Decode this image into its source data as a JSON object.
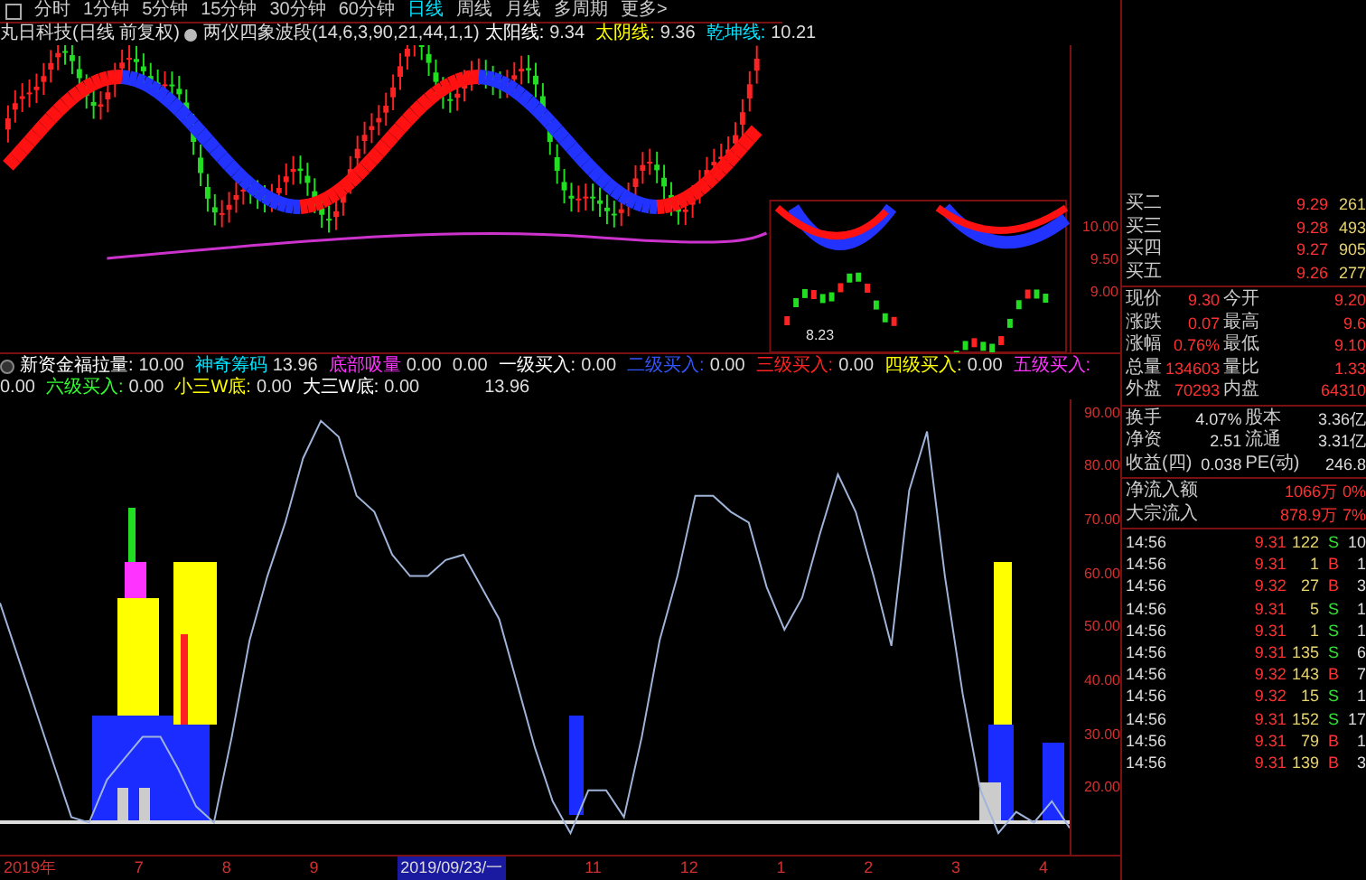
{
  "period_tabs": [
    {
      "label": "分时",
      "selected": false
    },
    {
      "label": "1分钟",
      "selected": false
    },
    {
      "label": "5分钟",
      "selected": false
    },
    {
      "label": "15分钟",
      "selected": false
    },
    {
      "label": "30分钟",
      "selected": false
    },
    {
      "label": "60分钟",
      "selected": false
    },
    {
      "label": "日线",
      "selected": true
    },
    {
      "label": "周线",
      "selected": false
    },
    {
      "label": "月线",
      "selected": false
    },
    {
      "label": "多周期",
      "selected": false
    },
    {
      "label": "更多>",
      "selected": false
    }
  ],
  "price_legend": {
    "title": "丸日科技(日线 前复权)",
    "indicator": "两仪四象波段(14,6,3,90,21,44,1,1)",
    "items": [
      {
        "label": "太阳线:",
        "value": "9.34",
        "color": "#ffffff"
      },
      {
        "label": "太阴线:",
        "value": "9.36",
        "color": "#ffff00"
      },
      {
        "label": "乾坤线:",
        "value": "10.21",
        "color": "#00e5ff"
      }
    ]
  },
  "price_axis": [
    "10.00",
    "9.50",
    "9.00"
  ],
  "inset_low_label": "8.23",
  "indicator_legend": {
    "items": [
      {
        "label": "新资金福拉量:",
        "values": [
          "10.00"
        ],
        "color": "#ffffff"
      },
      {
        "label": "神奇筹码",
        "values": [
          "13.96"
        ],
        "color": "#00e5ff"
      },
      {
        "label": "底部吸量",
        "values": [
          "0.00",
          "0.00"
        ],
        "color": "#ff33ff"
      },
      {
        "label": "一级买入:",
        "values": [
          "0.00"
        ],
        "color": "#ffffff"
      },
      {
        "label": "二级买入:",
        "values": [
          "0.00"
        ],
        "color": "#3355ff"
      },
      {
        "label": "三级买入:",
        "values": [
          "0.00"
        ],
        "color": "#ff2222"
      },
      {
        "label": "四级买入:",
        "values": [
          "0.00"
        ],
        "color": "#ffff00"
      },
      {
        "label": "五级买入:",
        "values": [
          "0.00"
        ],
        "color": "#ff33ff"
      },
      {
        "label": "六级买入:",
        "values": [
          "0.00"
        ],
        "color": "#33ff33"
      },
      {
        "label": "小三W底:",
        "values": [
          "0.00"
        ],
        "color": "#ffff00"
      },
      {
        "label": "大三W底:",
        "values": [
          "0.00"
        ],
        "color": "#ffffff"
      }
    ],
    "trailing_value": "13.96"
  },
  "indicator_chart": {
    "chart_data": {
      "type": "line",
      "ylim": [
        8,
        93
      ],
      "yticks": [
        {
          "value": 90,
          "label": "90.00"
        },
        {
          "value": 80,
          "label": "80.00"
        },
        {
          "value": 70,
          "label": "70.00"
        },
        {
          "value": 60,
          "label": "60.00"
        },
        {
          "value": 50,
          "label": "50.00"
        },
        {
          "value": 40,
          "label": "40.00"
        },
        {
          "value": 30,
          "label": "30.00"
        },
        {
          "value": 20,
          "label": "20.00"
        }
      ],
      "series": [
        {
          "color": "#9fb4d8",
          "values": [
            55,
            45,
            35,
            25,
            15,
            14,
            22,
            26,
            30,
            30,
            24,
            17,
            14,
            30,
            48,
            60,
            70,
            82,
            89,
            86,
            75,
            72,
            64,
            60,
            60,
            63,
            64,
            58,
            52,
            40,
            28,
            18,
            12,
            20,
            20,
            15,
            30,
            48,
            60,
            75,
            75,
            72,
            70,
            58,
            50,
            56,
            68,
            79,
            72,
            60,
            47,
            76,
            87,
            60,
            38,
            20,
            12,
            16,
            14,
            18,
            13
          ]
        }
      ]
    }
  },
  "time_axis": [
    {
      "label": "2019年",
      "selected": false
    },
    {
      "label": "7",
      "selected": false
    },
    {
      "label": "8",
      "selected": false
    },
    {
      "label": "9",
      "selected": false
    },
    {
      "label": "2019/09/23/一",
      "selected": true
    },
    {
      "label": "11",
      "selected": false
    },
    {
      "label": "12",
      "selected": false
    },
    {
      "label": "1",
      "selected": false
    },
    {
      "label": "2",
      "selected": false
    },
    {
      "label": "3",
      "selected": false
    },
    {
      "label": "4",
      "selected": false
    }
  ],
  "order_book": [
    {
      "label": "买二",
      "price": "9.29",
      "volume": "261"
    },
    {
      "label": "买三",
      "price": "9.28",
      "volume": "493"
    },
    {
      "label": "买四",
      "price": "9.27",
      "volume": "905"
    },
    {
      "label": "买五",
      "price": "9.26",
      "volume": "277"
    }
  ],
  "quote": [
    {
      "label": "现价",
      "value": "9.30",
      "label_2": "今开",
      "value_2": "9.20"
    },
    {
      "label": "涨跌",
      "value": "0.07",
      "label_2": "最高",
      "value_2": "9.6"
    },
    {
      "label": "涨幅",
      "value": "0.76%",
      "label_2": "最低",
      "value_2": "9.10"
    },
    {
      "label": "总量",
      "value": "134603",
      "label_2": "量比",
      "value_2": "1.33"
    },
    {
      "label": "外盘",
      "value": "70293",
      "label_2": "内盘",
      "value_2": "64310"
    }
  ],
  "fundamentals": [
    {
      "label": "换手",
      "value": "4.07%",
      "label_2": "股本",
      "value_2": "3.36亿"
    },
    {
      "label": "净资",
      "value": "2.51",
      "label_2": "流通",
      "value_2": "3.31亿"
    },
    {
      "label": "收益(四)",
      "value": "0.038",
      "label_2": "PE(动)",
      "value_2": "246.8"
    }
  ],
  "flows": [
    {
      "label": "净流入额",
      "value": "1066万",
      "share": "0%"
    },
    {
      "label": "大宗流入",
      "value": "878.9万",
      "share": "7%"
    }
  ],
  "trades": [
    {
      "time": "14:56",
      "price": "9.31",
      "volume": "122",
      "side": "S",
      "count": "10"
    },
    {
      "time": "14:56",
      "price": "9.31",
      "volume": "1",
      "side": "B",
      "count": "1"
    },
    {
      "time": "14:56",
      "price": "9.32",
      "volume": "27",
      "side": "B",
      "count": "3"
    },
    {
      "time": "14:56",
      "price": "9.31",
      "volume": "5",
      "side": "S",
      "count": "1"
    },
    {
      "time": "14:56",
      "price": "9.31",
      "volume": "1",
      "side": "S",
      "count": "1"
    },
    {
      "time": "14:56",
      "price": "9.31",
      "volume": "135",
      "side": "S",
      "count": "6"
    },
    {
      "time": "14:56",
      "price": "9.32",
      "volume": "143",
      "side": "B",
      "count": "7"
    },
    {
      "time": "14:56",
      "price": "9.32",
      "volume": "15",
      "side": "S",
      "count": "1"
    },
    {
      "time": "14:56",
      "price": "9.31",
      "volume": "152",
      "side": "S",
      "count": "17"
    },
    {
      "time": "14:56",
      "price": "9.31",
      "volume": "79",
      "side": "B",
      "count": "1"
    },
    {
      "time": "14:56",
      "price": "9.31",
      "volume": "139",
      "side": "B",
      "count": "3"
    }
  ]
}
